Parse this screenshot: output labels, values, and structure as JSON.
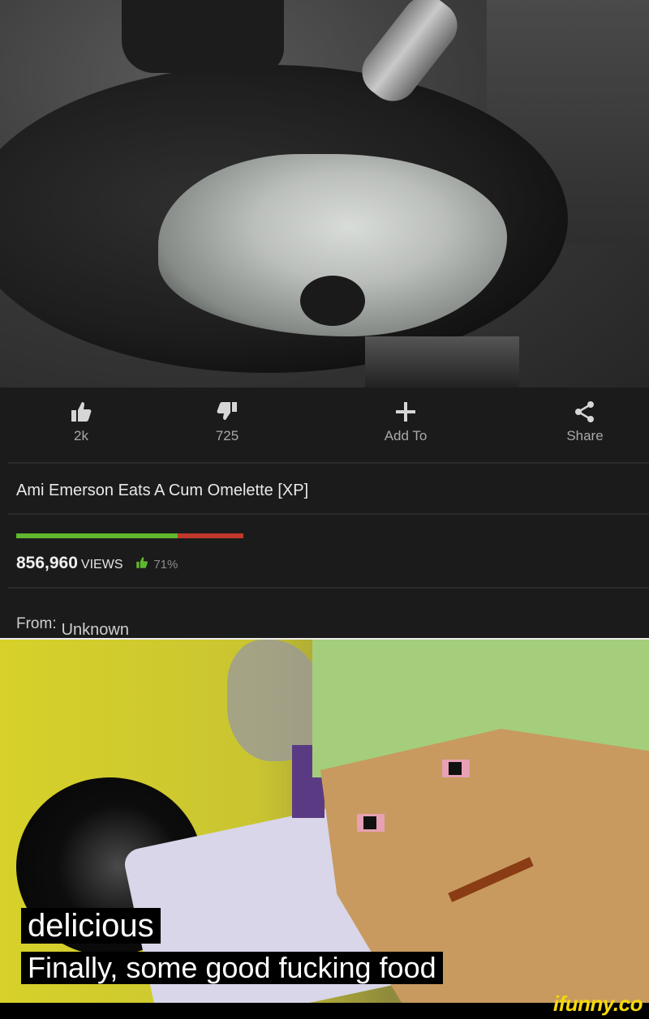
{
  "actions": [
    {
      "label": "2k",
      "icon": "thumbs-up-icon"
    },
    {
      "label": "725",
      "icon": "thumbs-down-icon"
    },
    {
      "label": "Add To",
      "icon": "plus-icon"
    },
    {
      "label": "Share",
      "icon": "share-icon"
    }
  ],
  "video": {
    "title": "Ami Emerson Eats A Cum Omelette [XP]",
    "views_count": "856,960",
    "views_word": "VIEWS",
    "rating_percent": "71%",
    "rating_fraction": 0.71,
    "from_label": "From:",
    "from_value": "Unknown"
  },
  "meme": {
    "caption_line1": "delicious",
    "caption_line2": "Finally, some good fucking food"
  },
  "watermark": "ifunny.co",
  "colors": {
    "rating_good": "#5fb82d",
    "rating_bad": "#c0392b",
    "watermark": "#f5d90a"
  }
}
